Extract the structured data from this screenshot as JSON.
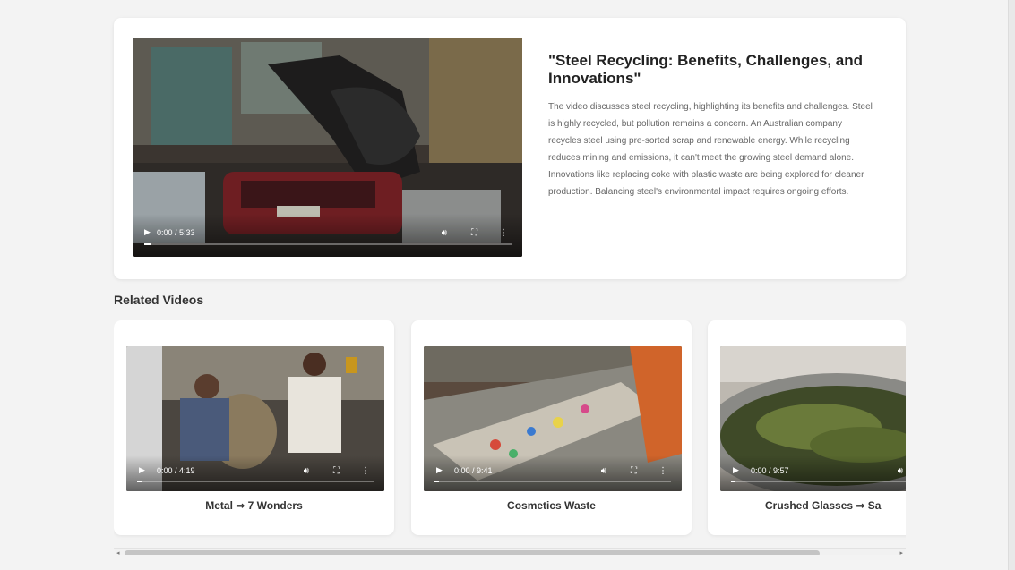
{
  "featured": {
    "title": "\"Steel Recycling: Benefits, Challenges, and Innovations\"",
    "description": "The video discusses steel recycling, highlighting its benefits and challenges. Steel is highly recycled, but pollution remains a concern. An Australian company recycles steel using pre-sorted scrap and renewable energy. While recycling reduces mining and emissions, it can't meet the growing steel demand alone. Innovations like replacing coke with plastic waste are being explored for cleaner production. Balancing steel's environmental impact requires ongoing efforts.",
    "video": {
      "time": "0:00 / 5:33",
      "progress": 0.02
    }
  },
  "related": {
    "heading": "Related Videos",
    "items": [
      {
        "title": "Metal ⇒ 7 Wonders",
        "time": "0:00 / 4:19"
      },
      {
        "title": "Cosmetics Waste",
        "time": "0:00 / 9:41"
      },
      {
        "title": "Crushed Glasses ⇒ Sa",
        "time": "0:00 / 9:57"
      }
    ]
  },
  "icons": {
    "play": "play-icon",
    "volume": "volume-icon",
    "fullscreen": "fullscreen-icon",
    "menu": "more-options-icon",
    "scroll_left": "arrow-left-icon",
    "scroll_right": "arrow-right-icon"
  }
}
